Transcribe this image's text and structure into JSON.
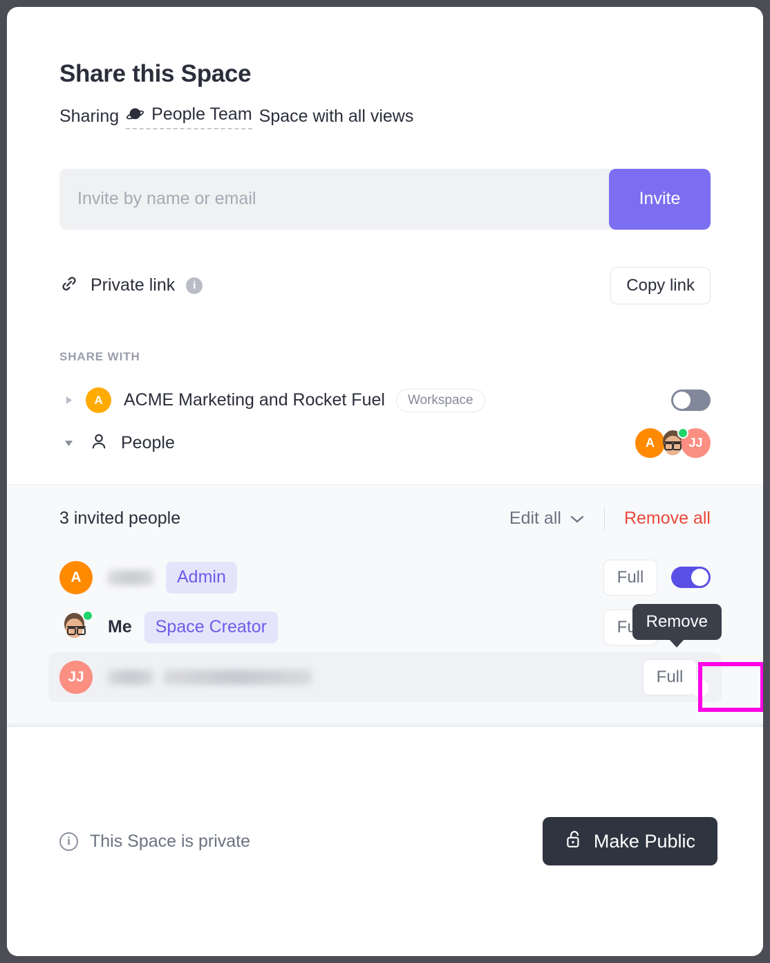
{
  "modal": {
    "title": "Share this Space",
    "subtitle": {
      "prefix": "Sharing",
      "space_name": "People Team",
      "space_icon": "planet-icon",
      "suffix": "Space with all views"
    }
  },
  "invite": {
    "placeholder": "Invite by name or email",
    "value": "",
    "button_label": "Invite"
  },
  "private_link": {
    "label": "Private link",
    "link_icon": "link-icon",
    "info_icon": "info-filled-icon",
    "info_glyph": "i",
    "copy_label": "Copy link"
  },
  "share_with": {
    "section_label": "SHARE WITH",
    "rows": [
      {
        "avatar_initial": "A",
        "avatar_color": "#ffab00",
        "name": "ACME Marketing and Rocket Fuel",
        "badge": "Workspace",
        "toggle_state": "off",
        "caret": "collapsed"
      },
      {
        "icon": "person-icon",
        "name": "People",
        "caret": "expanded",
        "avatars": [
          {
            "type": "initials",
            "initials": "A",
            "color": "#ff8a00"
          },
          {
            "type": "photo",
            "status": "online"
          },
          {
            "type": "initials",
            "initials": "JJ",
            "color": "#fa8f82"
          }
        ]
      }
    ]
  },
  "invited": {
    "count_label": "3 invited people",
    "edit_all_label": "Edit all",
    "edit_all_icon": "chevron-down-icon",
    "remove_all_label": "Remove all",
    "remove_all_color": "#e8493a",
    "people": [
      {
        "avatar_initial": "A",
        "avatar_color": "#ff8a00",
        "name": "",
        "name_blurred": true,
        "role": "Admin",
        "permission": "Full",
        "toggle_state": "on"
      },
      {
        "avatar_type": "photo",
        "status": "online",
        "name": "Me",
        "name_blurred": false,
        "role": "Space Creator",
        "permission": "Full",
        "toggle_state": "on"
      },
      {
        "avatar_initial": "JJ",
        "avatar_color": "#fa8f82",
        "name": "",
        "name_blurred": true,
        "role": "",
        "permission": "Full",
        "toggle_state": "on",
        "highlighted": true,
        "tooltip": "Remove"
      }
    ]
  },
  "footer": {
    "info_icon": "info-outline-icon",
    "info_glyph": "i",
    "status_text": "This Space is private",
    "make_public_label": "Make Public",
    "lock_icon": "unlocked-padlock-icon"
  },
  "colors": {
    "accent_purple": "#7b6ef0",
    "toggle_on": "#5b50e5",
    "toggle_off": "#808899",
    "danger": "#e8493a",
    "highlight": "#ff00e6",
    "dark_button": "#2f3540"
  }
}
